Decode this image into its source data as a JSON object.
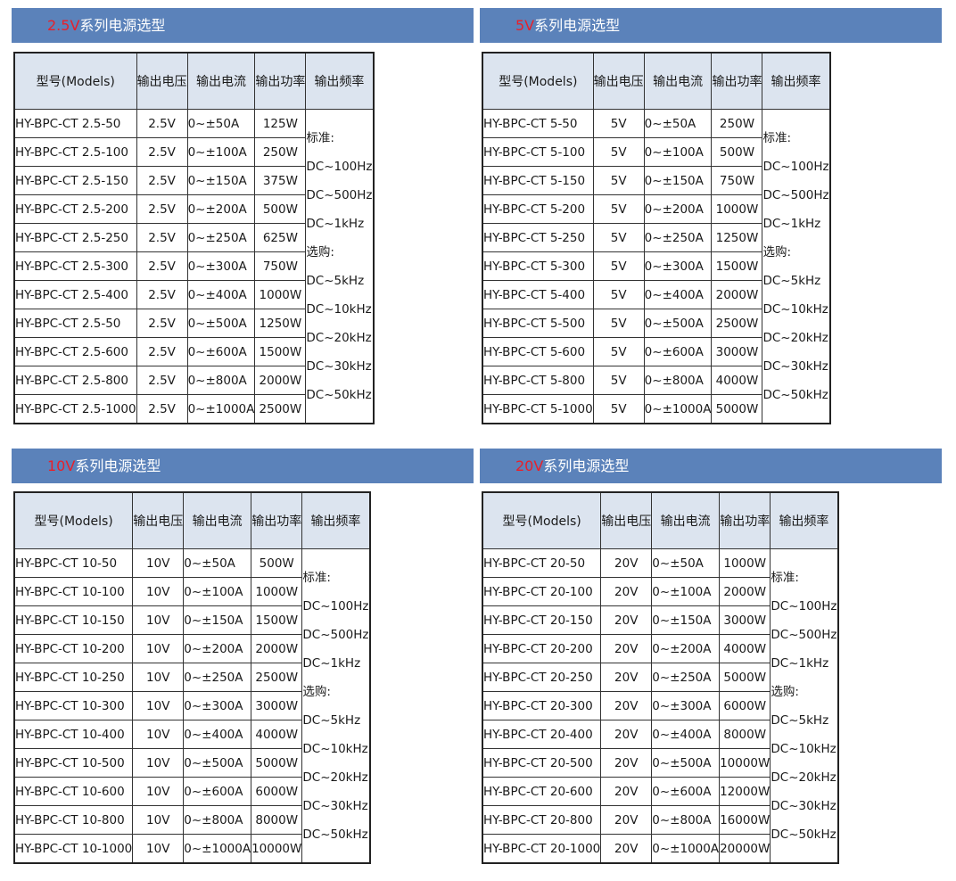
{
  "columns": [
    "型号(Models)",
    "输出电压",
    "输出电流",
    "输出功率",
    "输出频率"
  ],
  "title_suffix": "系列电源选型",
  "frequency": [
    "标准:",
    "DC~100Hz",
    "DC~500Hz",
    "DC~1kHz",
    "选购:",
    "DC~5kHz",
    "DC~10kHz",
    "DC~20kHz",
    "DC~30kHz",
    "DC~50kHz"
  ],
  "tables": [
    {
      "voltage_label": "2.5V",
      "rows": [
        [
          "HY-BPC-CT 2.5-50",
          "2.5V",
          "0~±50A",
          "125W"
        ],
        [
          "HY-BPC-CT 2.5-100",
          "2.5V",
          "0~±100A",
          "250W"
        ],
        [
          "HY-BPC-CT 2.5-150",
          "2.5V",
          "0~±150A",
          "375W"
        ],
        [
          "HY-BPC-CT 2.5-200",
          "2.5V",
          "0~±200A",
          "500W"
        ],
        [
          "HY-BPC-CT 2.5-250",
          "2.5V",
          "0~±250A",
          "625W"
        ],
        [
          "HY-BPC-CT 2.5-300",
          "2.5V",
          "0~±300A",
          "750W"
        ],
        [
          "HY-BPC-CT 2.5-400",
          "2.5V",
          "0~±400A",
          "1000W"
        ],
        [
          "HY-BPC-CT 2.5-50",
          "2.5V",
          "0~±500A",
          "1250W"
        ],
        [
          "HY-BPC-CT 2.5-600",
          "2.5V",
          "0~±600A",
          "1500W"
        ],
        [
          "HY-BPC-CT 2.5-800",
          "2.5V",
          "0~±800A",
          "2000W"
        ],
        [
          "HY-BPC-CT 2.5-1000",
          "2.5V",
          "0~±1000A",
          "2500W"
        ]
      ]
    },
    {
      "voltage_label": "5V",
      "rows": [
        [
          "HY-BPC-CT 5-50",
          "5V",
          "0~±50A",
          "250W"
        ],
        [
          "HY-BPC-CT 5-100",
          "5V",
          "0~±100A",
          "500W"
        ],
        [
          "HY-BPC-CT 5-150",
          "5V",
          "0~±150A",
          "750W"
        ],
        [
          "HY-BPC-CT 5-200",
          "5V",
          "0~±200A",
          "1000W"
        ],
        [
          "HY-BPC-CT 5-250",
          "5V",
          "0~±250A",
          "1250W"
        ],
        [
          "HY-BPC-CT 5-300",
          "5V",
          "0~±300A",
          "1500W"
        ],
        [
          "HY-BPC-CT 5-400",
          "5V",
          "0~±400A",
          "2000W"
        ],
        [
          "HY-BPC-CT 5-500",
          "5V",
          "0~±500A",
          "2500W"
        ],
        [
          "HY-BPC-CT 5-600",
          "5V",
          "0~±600A",
          "3000W"
        ],
        [
          "HY-BPC-CT 5-800",
          "5V",
          "0~±800A",
          "4000W"
        ],
        [
          "HY-BPC-CT 5-1000",
          "5V",
          "0~±1000A",
          "5000W"
        ]
      ]
    },
    {
      "voltage_label": "10V",
      "rows": [
        [
          "HY-BPC-CT 10-50",
          "10V",
          "0~±50A",
          "500W"
        ],
        [
          "HY-BPC-CT 10-100",
          "10V",
          "0~±100A",
          "1000W"
        ],
        [
          "HY-BPC-CT 10-150",
          "10V",
          "0~±150A",
          "1500W"
        ],
        [
          "HY-BPC-CT 10-200",
          "10V",
          "0~±200A",
          "2000W"
        ],
        [
          "HY-BPC-CT 10-250",
          "10V",
          "0~±250A",
          "2500W"
        ],
        [
          "HY-BPC-CT 10-300",
          "10V",
          "0~±300A",
          "3000W"
        ],
        [
          "HY-BPC-CT 10-400",
          "10V",
          "0~±400A",
          "4000W"
        ],
        [
          "HY-BPC-CT 10-500",
          "10V",
          "0~±500A",
          "5000W"
        ],
        [
          "HY-BPC-CT 10-600",
          "10V",
          "0~±600A",
          "6000W"
        ],
        [
          "HY-BPC-CT 10-800",
          "10V",
          "0~±800A",
          "8000W"
        ],
        [
          "HY-BPC-CT 10-1000",
          "10V",
          "0~±1000A",
          "10000W"
        ]
      ]
    },
    {
      "voltage_label": "20V",
      "rows": [
        [
          "HY-BPC-CT 20-50",
          "20V",
          "0~±50A",
          "1000W"
        ],
        [
          "HY-BPC-CT 20-100",
          "20V",
          "0~±100A",
          "2000W"
        ],
        [
          "HY-BPC-CT 20-150",
          "20V",
          "0~±150A",
          "3000W"
        ],
        [
          "HY-BPC-CT 20-200",
          "20V",
          "0~±200A",
          "4000W"
        ],
        [
          "HY-BPC-CT 20-250",
          "20V",
          "0~±250A",
          "5000W"
        ],
        [
          "HY-BPC-CT 20-300",
          "20V",
          "0~±300A",
          "6000W"
        ],
        [
          "HY-BPC-CT 20-400",
          "20V",
          "0~±400A",
          "8000W"
        ],
        [
          "HY-BPC-CT 20-500",
          "20V",
          "0~±500A",
          "10000W"
        ],
        [
          "HY-BPC-CT 20-600",
          "20V",
          "0~±600A",
          "12000W"
        ],
        [
          "HY-BPC-CT 20-800",
          "20V",
          "0~±800A",
          "16000W"
        ],
        [
          "HY-BPC-CT 20-1000",
          "20V",
          "0~±1000A",
          "20000W"
        ]
      ]
    }
  ]
}
